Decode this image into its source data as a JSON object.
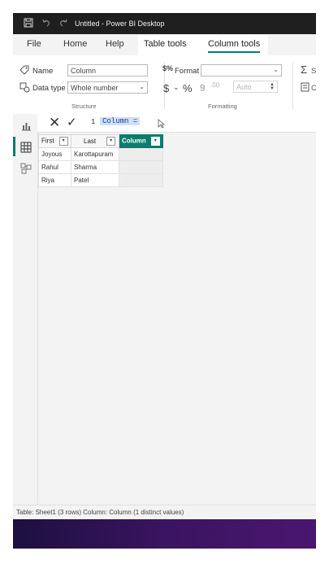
{
  "window": {
    "title": "Untitled - Power BI Desktop",
    "icons": [
      "save-icon",
      "undo-icon",
      "redo-icon"
    ]
  },
  "menu": {
    "tabs": [
      "File",
      "Home",
      "Help",
      "Table tools",
      "Column tools"
    ],
    "active": "Column tools"
  },
  "ribbon": {
    "structure": {
      "name_label": "Name",
      "name_value": "Column",
      "datatype_label": "Data type",
      "datatype_value": "Whole number",
      "group_label": "Structure"
    },
    "formatting": {
      "format_label": "Format",
      "format_value": "",
      "currency_symbol": "$",
      "percent_symbol": "%",
      "comma_symbol": "9",
      "decimal_symbol": ".00",
      "auto_value": "Auto",
      "group_label": "Formatting"
    },
    "properties": {
      "summarize_partial": "S",
      "category_partial": "C"
    }
  },
  "formula": {
    "line_number": "1",
    "expression": "Column ="
  },
  "table": {
    "columns": [
      "First",
      "Last",
      "Column"
    ],
    "rows": [
      [
        "Joyous",
        "Karottapuram",
        ""
      ],
      [
        "Rahul",
        "Sharma",
        ""
      ],
      [
        "Riya",
        "Patel",
        ""
      ]
    ]
  },
  "status": {
    "text": "Table: Sheet1 (3 rows) Column: Column (1 distinct values)"
  },
  "colors": {
    "accent": "#0f7b6c",
    "titlebar": "#1f1f1f",
    "selection": "#cfe0fb"
  }
}
